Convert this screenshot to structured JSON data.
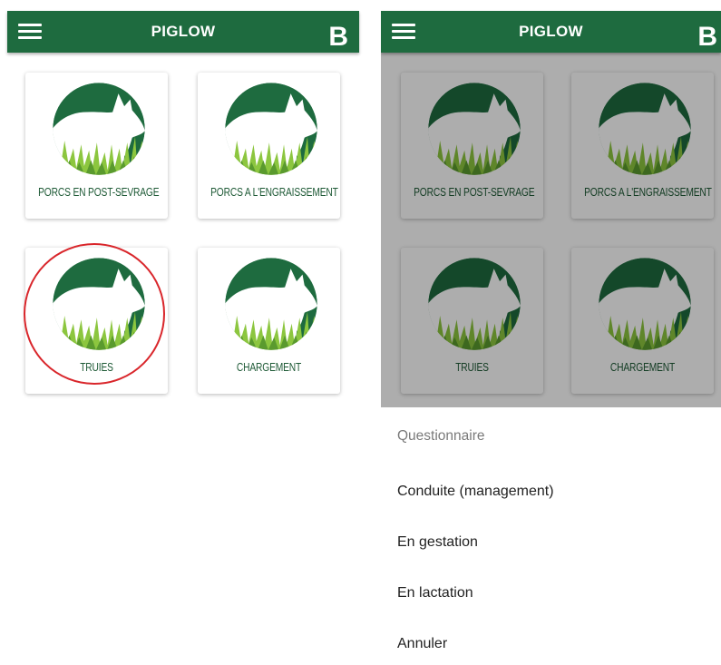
{
  "colors": {
    "appbar": "#1e6b3f",
    "logo_dark": "#1e6b3f",
    "grass_light": "#8cc63f",
    "label_text": "#1e5a36",
    "highlight": "#d9262b"
  },
  "left": {
    "app_title": "PIGLOW",
    "badge": "B",
    "menu_icon": "hamburger-menu-icon",
    "cards": [
      {
        "label": "PORCS EN POST-SEVRAGE",
        "icon": "pig-logo-icon"
      },
      {
        "label": "PORCS A L'ENGRAISSEMENT",
        "icon": "pig-logo-icon"
      },
      {
        "label": "TRUIES",
        "icon": "pig-logo-icon"
      },
      {
        "label": "CHARGEMENT",
        "icon": "pig-logo-icon"
      }
    ]
  },
  "right": {
    "app_title": "PIGLOW",
    "badge": "B",
    "menu_icon": "hamburger-menu-icon",
    "cards": [
      {
        "label": "PORCS EN POST-SEVRAGE",
        "icon": "pig-logo-icon"
      },
      {
        "label": "PORCS A L'ENGRAISSEMENT",
        "icon": "pig-logo-icon"
      },
      {
        "label": "TRUIES",
        "icon": "pig-logo-icon"
      },
      {
        "label": "CHARGEMENT",
        "icon": "pig-logo-icon"
      }
    ],
    "sheet": {
      "title": "Questionnaire",
      "items": [
        {
          "label": "Conduite (management)"
        },
        {
          "label": "En gestation"
        },
        {
          "label": "En lactation"
        },
        {
          "label": "Annuler"
        }
      ]
    }
  }
}
